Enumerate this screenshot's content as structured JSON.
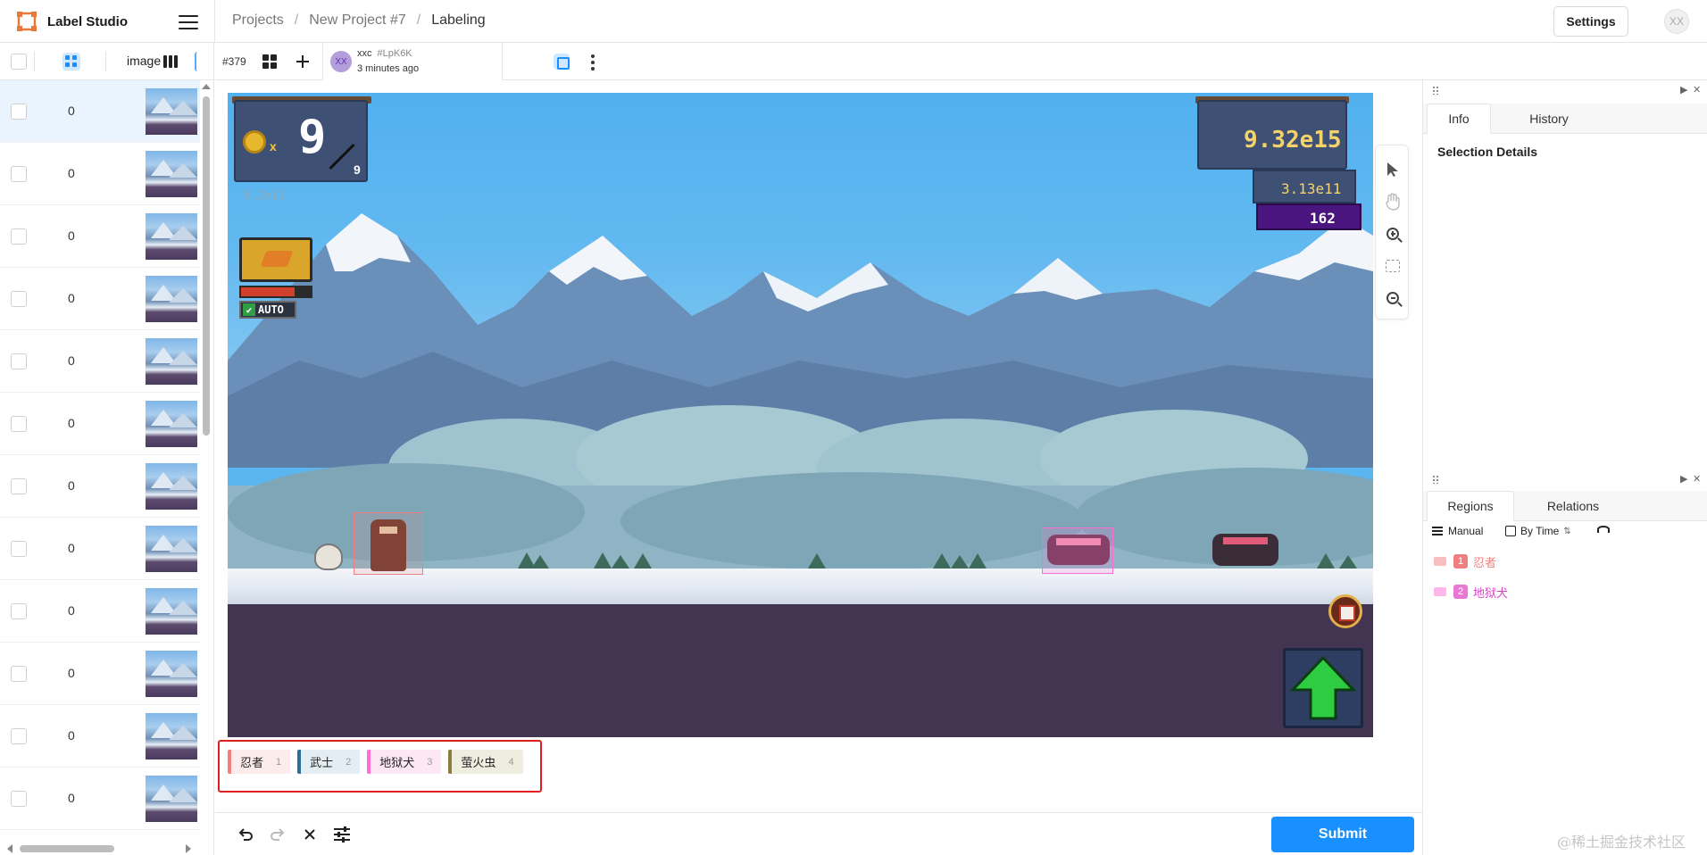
{
  "app": {
    "name": "Label Studio",
    "accent": "#1890ff",
    "user_initials": "XX",
    "settings_label": "Settings"
  },
  "breadcrumb": [
    "Projects",
    "New Project #7",
    "Labeling"
  ],
  "breadcrumb_sep": "/",
  "tasklist": {
    "header": {
      "column_label": "image"
    },
    "rows": [
      {
        "value": "0",
        "active": true
      },
      {
        "value": "0"
      },
      {
        "value": "0"
      },
      {
        "value": "0"
      },
      {
        "value": "0"
      },
      {
        "value": "0"
      },
      {
        "value": "0"
      },
      {
        "value": "0"
      },
      {
        "value": "0"
      },
      {
        "value": "0"
      },
      {
        "value": "0"
      },
      {
        "value": "0"
      }
    ]
  },
  "annotation_bar": {
    "task_id": "#379",
    "annotator_initials": "XX",
    "annotator_name": "xxc",
    "annotation_hash": "#LpK6K",
    "time_ago": "3 minutes ago"
  },
  "hud": {
    "top_left_big": "9",
    "top_left_small": "9",
    "top_left_multiplier": "x",
    "top_left_faded": "8.2e12",
    "auto_label": "AUTO",
    "top_right_value": "9.32e15",
    "top_right_sub": "3.13e11",
    "gem_value": "162"
  },
  "image_tools": [
    "cursor-icon",
    "hand-icon",
    "zoom-in-icon",
    "fit-icon",
    "zoom-out-icon"
  ],
  "labels": [
    {
      "text": "忍者",
      "hotkey": "1",
      "color": "#f08080",
      "bg": "#fdecec"
    },
    {
      "text": "武士",
      "hotkey": "2",
      "color": "#2a6f97",
      "bg": "#e3edf3"
    },
    {
      "text": "地狱犬",
      "hotkey": "3",
      "color": "#ff6ed1",
      "bg": "#fde7f6"
    },
    {
      "text": "萤火虫",
      "hotkey": "4",
      "color": "#8b7d3a",
      "bg": "#efece0"
    }
  ],
  "actions": {
    "submit": "Submit"
  },
  "info_panel": {
    "tabs": [
      "Info",
      "History"
    ],
    "title": "Selection Details"
  },
  "regions_panel": {
    "tabs": [
      "Regions",
      "Relations"
    ],
    "manual": "Manual",
    "by_time": "By Time",
    "items": [
      {
        "index": "1",
        "label": "忍者"
      },
      {
        "index": "2",
        "label": "地狱犬"
      }
    ]
  },
  "watermark": "@稀土掘金技术社区"
}
